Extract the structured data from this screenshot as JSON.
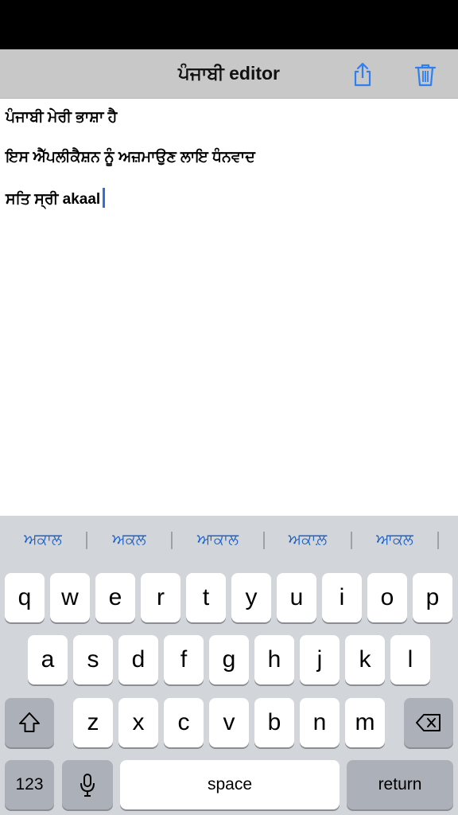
{
  "nav": {
    "title": "ਪੰਜਾਬੀ editor",
    "share_icon": "share-icon",
    "trash_icon": "trash-icon",
    "accent": "#2f7ff0"
  },
  "editor": {
    "lines": [
      "ਪੰਜਾਬੀ ਮੇਰੀ ਭਾਸ਼ਾ ਹੈ",
      "ਇਸ ਐੱਪਲੀਕੈਸ਼ਨ ਨੂੰ ਅਜ਼ਮਾਉਣ ਲਾਇ ਧੰਨਵਾਦ",
      "ਸਤਿ ਸ੍ਰੀ akaal"
    ],
    "caret_color": "#2f6fd6"
  },
  "suggestions": [
    "ਅਕਾਲ",
    "ਅਕਲ",
    "ਆਕਾਲ",
    "ਅਕਾਲ਼",
    "ਆਕਲ"
  ],
  "keyboard": {
    "row1": [
      "q",
      "w",
      "e",
      "r",
      "t",
      "y",
      "u",
      "i",
      "o",
      "p"
    ],
    "row2": [
      "a",
      "s",
      "d",
      "f",
      "g",
      "h",
      "j",
      "k",
      "l"
    ],
    "row3": [
      "z",
      "x",
      "c",
      "v",
      "b",
      "n",
      "m"
    ],
    "numbers_label": "123",
    "space_label": "space",
    "return_label": "return",
    "shift_icon": "shift-icon",
    "delete_icon": "delete-icon",
    "mic_icon": "microphone-icon"
  }
}
